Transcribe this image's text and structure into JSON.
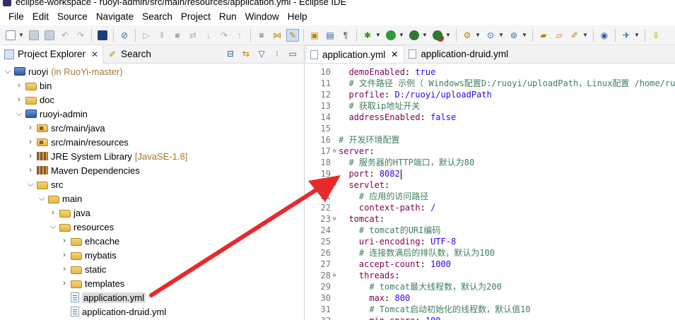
{
  "window": {
    "title": "eclipse-workspace - ruoyi-admin/src/main/resources/application.yml - Eclipse IDE"
  },
  "menubar": {
    "items": [
      "File",
      "Edit",
      "Source",
      "Navigate",
      "Search",
      "Project",
      "Run",
      "Window",
      "Help"
    ]
  },
  "colors": {
    "keyword": "#7f0055",
    "value": "#2a00ff",
    "comment": "#3f7f5f",
    "annotation_arrow": "#e8292b"
  },
  "left_panel": {
    "tabs": [
      {
        "label": "Project Explorer",
        "icon": "project-explorer-icon",
        "active": true
      },
      {
        "label": "Search",
        "icon": "search-icon",
        "active": false
      }
    ],
    "tree": [
      {
        "label": "ruoyi",
        "decor": "(in RuoYi-master)",
        "expanded": true,
        "icon": "project-icon"
      },
      {
        "label": "bin",
        "expanded": false,
        "icon": "folder-icon"
      },
      {
        "label": "doc",
        "expanded": false,
        "icon": "folder-icon"
      },
      {
        "label": "ruoyi-admin",
        "expanded": true,
        "icon": "project-icon"
      },
      {
        "label": "src/main/java",
        "expanded": false,
        "icon": "source-folder-icon"
      },
      {
        "label": "src/main/resources",
        "expanded": false,
        "icon": "source-folder-icon"
      },
      {
        "label": "JRE System Library",
        "decor": "[JavaSE-1.8]",
        "expanded": false,
        "icon": "library-icon"
      },
      {
        "label": "Maven Dependencies",
        "expanded": false,
        "icon": "library-icon"
      },
      {
        "label": "src",
        "expanded": true,
        "icon": "folder-icon"
      },
      {
        "label": "main",
        "expanded": true,
        "icon": "folder-icon"
      },
      {
        "label": "java",
        "expanded": false,
        "icon": "folder-icon"
      },
      {
        "label": "resources",
        "expanded": true,
        "icon": "folder-icon"
      },
      {
        "label": "ehcache",
        "expanded": false,
        "icon": "folder-icon"
      },
      {
        "label": "mybatis",
        "expanded": false,
        "icon": "folder-icon"
      },
      {
        "label": "static",
        "expanded": false,
        "icon": "folder-icon"
      },
      {
        "label": "templates",
        "expanded": false,
        "icon": "folder-icon"
      },
      {
        "label": "application.yml",
        "icon": "yml-file-icon",
        "selected": true
      },
      {
        "label": "application-druid.yml",
        "icon": "yml-file-icon"
      }
    ]
  },
  "editor": {
    "tabs": [
      {
        "label": "application.yml",
        "active": true
      },
      {
        "label": "application-druid.yml",
        "active": false
      }
    ],
    "lines": [
      {
        "n": "10",
        "fold": "",
        "indent": "  ",
        "key": "demoEnabled",
        "value": "true"
      },
      {
        "n": "11",
        "fold": "",
        "indent": "  ",
        "comment": "# 文件路径 示例（ Windows配置D:/ruoyi/uploadPath，Linux配置 /home/ruoy"
      },
      {
        "n": "12",
        "fold": "",
        "indent": "  ",
        "key": "profile",
        "value": "D:/ruoyi/uploadPath"
      },
      {
        "n": "13",
        "fold": "",
        "indent": "  ",
        "comment": "# 获取ip地址开关"
      },
      {
        "n": "14",
        "fold": "",
        "indent": "  ",
        "key": "addressEnabled",
        "value": "false"
      },
      {
        "n": "15",
        "fold": "",
        "indent": ""
      },
      {
        "n": "16",
        "fold": "",
        "indent": "",
        "comment": "# 开发环境配置"
      },
      {
        "n": "17",
        "fold": "⊖",
        "indent": "",
        "key": "server",
        "value": ""
      },
      {
        "n": "18",
        "fold": "",
        "indent": "  ",
        "comment": "# 服务器的HTTP端口，默认为80"
      },
      {
        "n": "19",
        "fold": "",
        "indent": "  ",
        "key": "port",
        "value": "8082",
        "caret": true
      },
      {
        "n": "20",
        "fold": "⊖",
        "indent": "  ",
        "key": "servlet",
        "value": ""
      },
      {
        "n": "21",
        "fold": "",
        "indent": "    ",
        "comment": "# 应用的访问路径"
      },
      {
        "n": "22",
        "fold": "",
        "indent": "    ",
        "key": "context-path",
        "value": "/"
      },
      {
        "n": "23",
        "fold": "⊖",
        "indent": "  ",
        "key": "tomcat",
        "value": ""
      },
      {
        "n": "24",
        "fold": "",
        "indent": "    ",
        "comment": "# tomcat的URI编码"
      },
      {
        "n": "25",
        "fold": "",
        "indent": "    ",
        "key": "uri-encoding",
        "value": "UTF-8"
      },
      {
        "n": "26",
        "fold": "",
        "indent": "    ",
        "comment": "# 连接数满后的排队数，默认为100"
      },
      {
        "n": "27",
        "fold": "",
        "indent": "    ",
        "key": "accept-count",
        "value": "1000"
      },
      {
        "n": "28",
        "fold": "⊖",
        "indent": "    ",
        "key": "threads",
        "value": ""
      },
      {
        "n": "29",
        "fold": "",
        "indent": "      ",
        "comment": "# tomcat最大线程数，默认为200"
      },
      {
        "n": "30",
        "fold": "",
        "indent": "      ",
        "key": "max",
        "value": "800"
      },
      {
        "n": "31",
        "fold": "",
        "indent": "      ",
        "comment": "# Tomcat启动初始化的线程数，默认值10"
      },
      {
        "n": "32",
        "fold": "",
        "indent": "      ",
        "key": "min-spare",
        "value": "100"
      }
    ]
  }
}
